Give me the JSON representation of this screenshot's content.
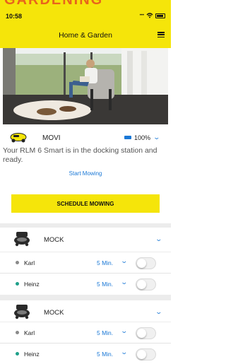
{
  "top_banner": {
    "text": "GARDENING"
  },
  "status_bar": {
    "time": "10:58"
  },
  "header": {
    "title": "Home & Garden"
  },
  "robot": {
    "name": "MOVI",
    "battery": "100%",
    "status": "Your RLM 6 Smart is in the docking station and ready.",
    "start_label": "Start Mowing",
    "schedule_label": "SCHEDULE MOWING"
  },
  "mocks": [
    {
      "name": "MOCK",
      "users": [
        {
          "name": "Karl",
          "duration": "5 Min.",
          "dot_color": "#8a8a8a"
        },
        {
          "name": "Heinz",
          "duration": "5 Min.",
          "dot_color": "#1fa08a"
        }
      ]
    },
    {
      "name": "MOCK",
      "users": [
        {
          "name": "Karl",
          "duration": "5 Min.",
          "dot_color": "#8a8a8a"
        },
        {
          "name": "Heinz",
          "duration": "5 Min.",
          "dot_color": "#1fa08a"
        }
      ]
    }
  ],
  "colors": {
    "brand_yellow": "#f5e50a",
    "accent_blue": "#1a78d6",
    "banner_orange": "#e8641c"
  },
  "icons": {
    "menu": "menu-icon",
    "mower": "mower-icon",
    "battery": "battery-icon",
    "chevron": "chevron-down-icon",
    "robot": "robot-vacuum-icon"
  }
}
